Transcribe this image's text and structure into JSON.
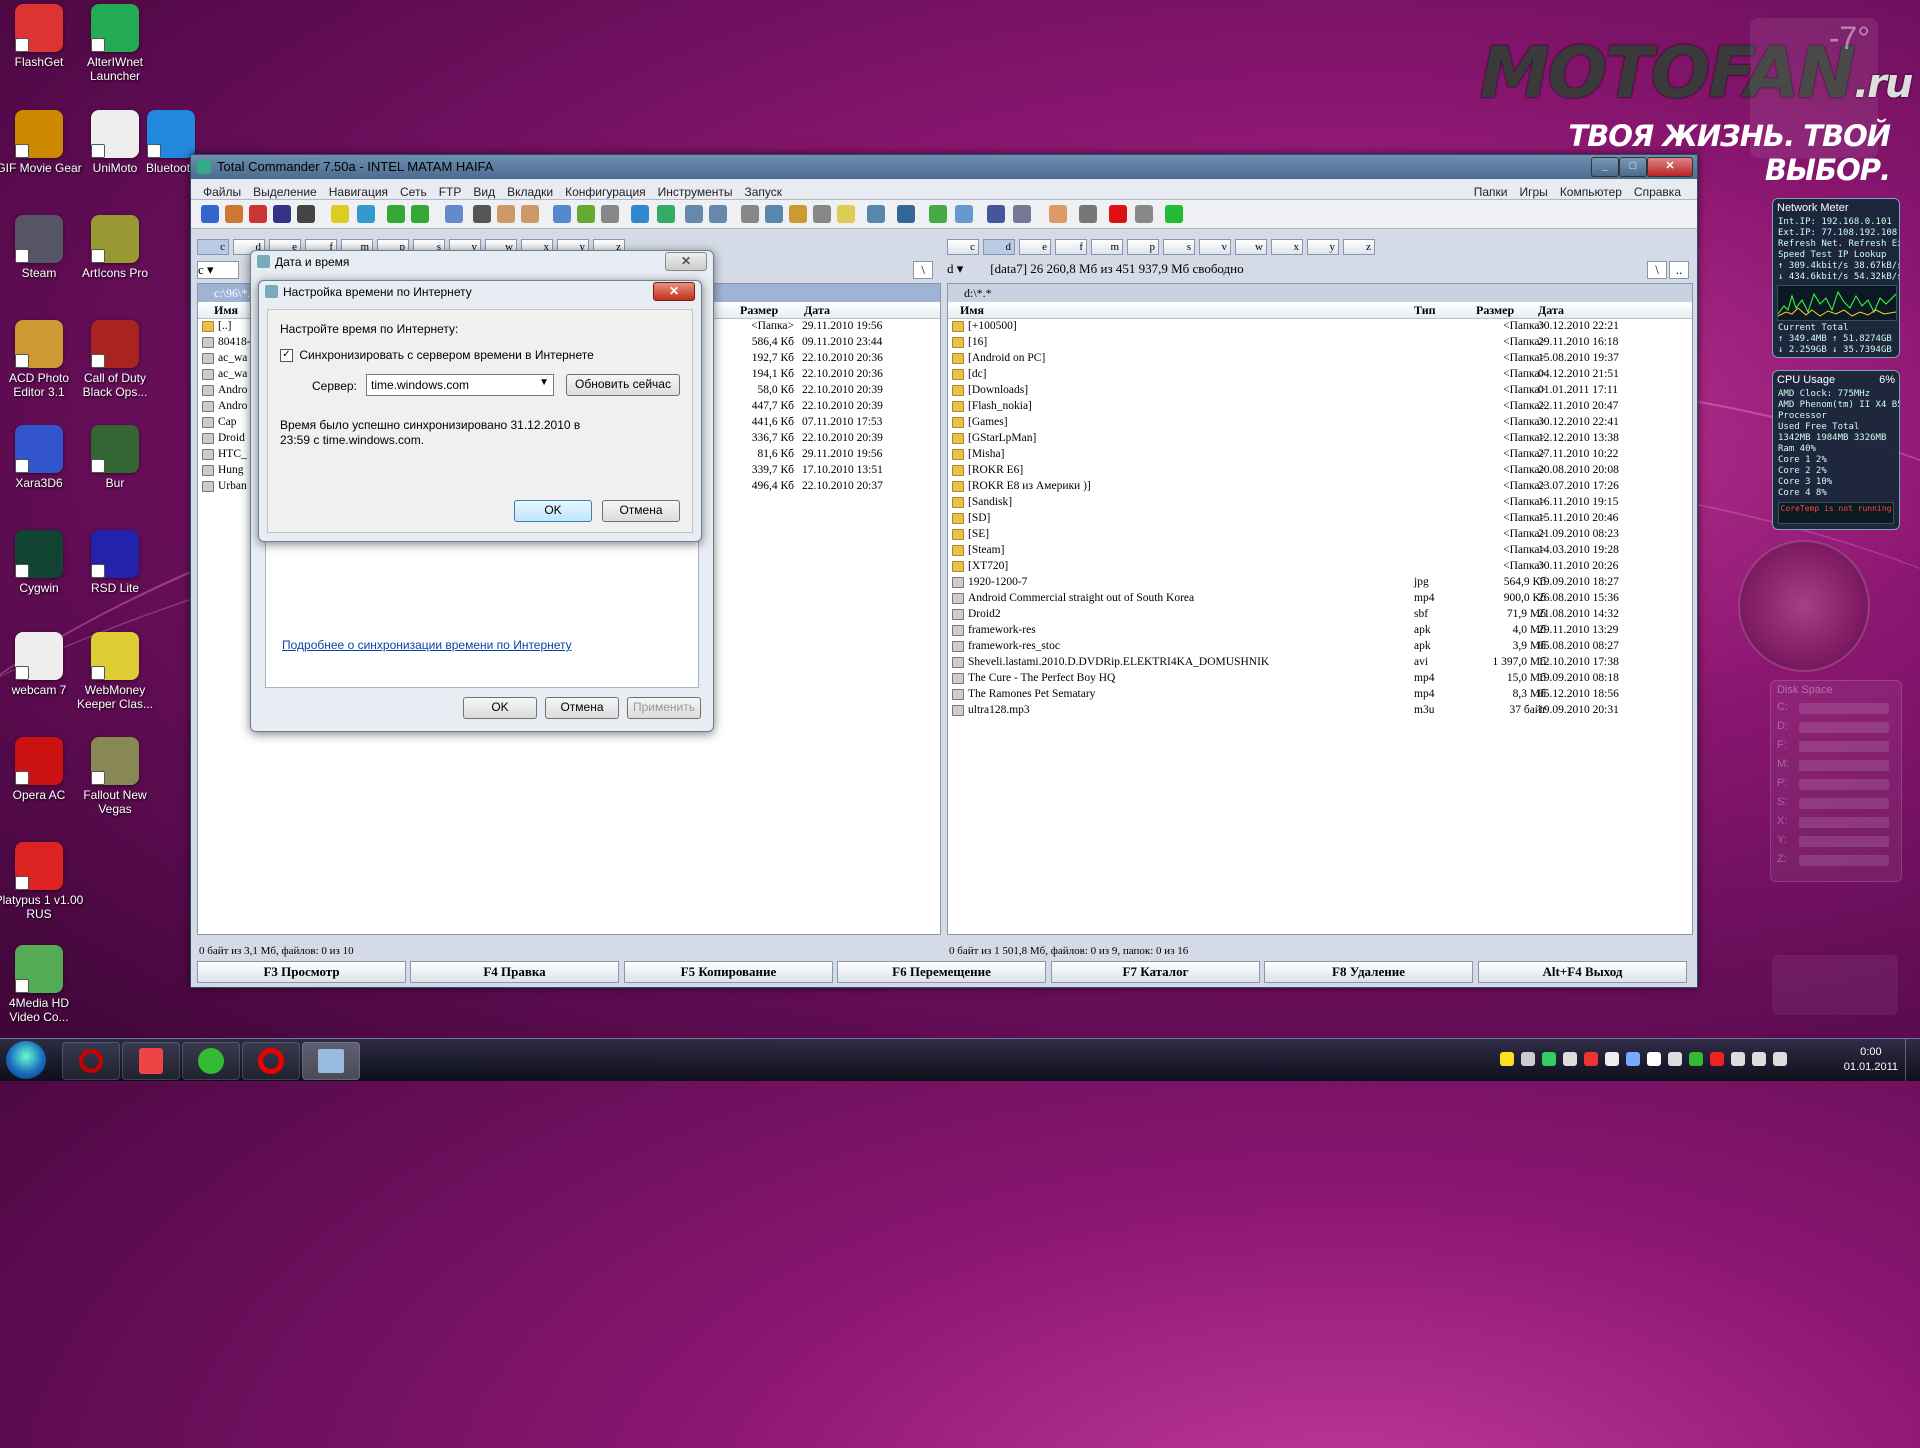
{
  "desktop": {
    "icons": [
      {
        "label": "FlashGet"
      },
      {
        "label": "AlterIWnet Launcher"
      },
      {
        "label": "GIF Movie Gear"
      },
      {
        "label": "UniMoto"
      },
      {
        "label": "Bluetooth"
      },
      {
        "label": "Steam"
      },
      {
        "label": "ArtIcons Pro"
      },
      {
        "label": "ACD Photo Editor 3.1"
      },
      {
        "label": "Call of Duty Black Ops..."
      },
      {
        "label": "Xara3D6"
      },
      {
        "label": "Bur"
      },
      {
        "label": "Cygwin"
      },
      {
        "label": "RSD Lite"
      },
      {
        "label": "webcam 7"
      },
      {
        "label": "WebMoney Keeper Clas..."
      },
      {
        "label": "Opera AC"
      },
      {
        "label": "Fallout New Vegas"
      },
      {
        "label": "Platypus 1 v1.00 RUS"
      },
      {
        "label": "4Media HD Video Co..."
      }
    ],
    "logo_main": "MOTOFAN",
    "logo_ru": ".ru",
    "logo_sub": "ТВОЯ ЖИЗНЬ. ТВОЙ ВЫБОР.",
    "weather_temp": "-7°"
  },
  "gadgets": {
    "network": {
      "title": "Network Meter",
      "rows": [
        "Int.IP: 192.168.0.101",
        "Ext.IP: 77.108.192.108",
        "Refresh Net.   Refresh Ext.",
        "Speed Test     IP Lookup",
        "↑ 309.4kbit/s   38.67kB/s",
        "↓ 434.6kbit/s   54.32kB/s"
      ],
      "foot": [
        "Current       Total",
        "↑ 349.4MB   ↑ 51.8274GB",
        "↓ 2.259GB   ↓ 35.7394GB"
      ]
    },
    "cpu": {
      "title": "CPU Usage",
      "percent": "6%",
      "rows": [
        "AMD     Clock:  775MHz",
        "AMD Phenom(tm) II X4 B50",
        "Processor",
        "Used     Free     Total",
        "1342MB  1984MB  3326MB",
        "Ram          40%",
        "Core 1        2%",
        "Core 2        2%",
        "Core 3       10%",
        "Core 4        8%"
      ],
      "warn": "CoreTemp is not running"
    },
    "disk": {
      "title": "Disk Space",
      "drives": [
        "C:",
        "D:",
        "F:",
        "M:",
        "P:",
        "S:",
        "X:",
        "Y:",
        "Z:"
      ]
    }
  },
  "tc": {
    "title": "Total Commander 7.50a - INTEL MATAM HAIFA",
    "menu": [
      "Файлы",
      "Выделение",
      "Навигация",
      "Сеть",
      "FTP",
      "Вид",
      "Вкладки",
      "Конфигурация",
      "Инструменты",
      "Запуск"
    ],
    "menu_right": [
      "Папки",
      "Игры",
      "Компьютер",
      "Справка"
    ],
    "left": {
      "drives": [
        "c",
        "d",
        "e",
        "f",
        "m",
        "p",
        "s",
        "v",
        "w",
        "x",
        "y",
        "z"
      ],
      "drive_sel": "c",
      "path": "c:\\96\\*.*",
      "cols": {
        "name": "Имя",
        "size": "Размер",
        "date": "Дата"
      },
      "files": [
        {
          "name": "[..]",
          "size": "<Папка>",
          "date": "29.11.2010 19:56",
          "type": "folder"
        },
        {
          "name": "80418-",
          "size": "586,4 Кб",
          "date": "09.11.2010 23:44",
          "type": "file"
        },
        {
          "name": "ac_wa",
          "size": "192,7 Кб",
          "date": "22.10.2010 20:36",
          "type": "file"
        },
        {
          "name": "ac_wa",
          "size": "194,1 Кб",
          "date": "22.10.2010 20:36",
          "type": "file"
        },
        {
          "name": "Andro",
          "size": "58,0 Кб",
          "date": "22.10.2010 20:39",
          "type": "file"
        },
        {
          "name": "Andro",
          "size": "447,7 Кб",
          "date": "22.10.2010 20:39",
          "type": "file"
        },
        {
          "name": "Cap",
          "size": "441,6 Кб",
          "date": "07.11.2010 17:53",
          "type": "file"
        },
        {
          "name": "Droid",
          "size": "336,7 Кб",
          "date": "22.10.2010 20:39",
          "type": "file"
        },
        {
          "name": "HTC_",
          "size": "81,6 Кб",
          "date": "29.11.2010 19:56",
          "type": "file"
        },
        {
          "name": "Hung",
          "size": "339,7 Кб",
          "date": "17.10.2010 13:51",
          "type": "file"
        },
        {
          "name": "Urban",
          "size": "496,4 Кб",
          "date": "22.10.2010 20:37",
          "type": "file"
        }
      ],
      "status": "0 байт из 3,1 Мб, файлов: 0 из 10"
    },
    "right": {
      "drives": [
        "c",
        "d",
        "e",
        "f",
        "m",
        "p",
        "s",
        "v",
        "w",
        "x",
        "y",
        "z"
      ],
      "drive_sel": "d",
      "drive_letter": "d",
      "drive_info": "[data7]  26 260,8 Мб из 451 937,9 Мб свободно",
      "path": "d:\\*.*",
      "cols": {
        "name": "Имя",
        "type": "Тип",
        "size": "Размер",
        "date": "Дата"
      },
      "files": [
        {
          "name": "[+100500]",
          "ext": "",
          "size": "<Папка>",
          "date": "30.12.2010 22:21",
          "type": "folder"
        },
        {
          "name": "[16]",
          "ext": "",
          "size": "<Папка>",
          "date": "29.11.2010 16:18",
          "type": "folder"
        },
        {
          "name": "[Android on PC]",
          "ext": "",
          "size": "<Папка>",
          "date": "15.08.2010 19:37",
          "type": "folder"
        },
        {
          "name": "[dc]",
          "ext": "",
          "size": "<Папка>",
          "date": "04.12.2010 21:51",
          "type": "folder"
        },
        {
          "name": "[Downloads]",
          "ext": "",
          "size": "<Папка>",
          "date": "01.01.2011 17:11",
          "type": "folder"
        },
        {
          "name": "[Flash_nokia]",
          "ext": "",
          "size": "<Папка>",
          "date": "22.11.2010 20:47",
          "type": "folder"
        },
        {
          "name": "[Games]",
          "ext": "",
          "size": "<Папка>",
          "date": "30.12.2010 22:41",
          "type": "folder"
        },
        {
          "name": "[GStarLpMan]",
          "ext": "",
          "size": "<Папка>",
          "date": "12.12.2010 13:38",
          "type": "folder"
        },
        {
          "name": "[Misha]",
          "ext": "",
          "size": "<Папка>",
          "date": "27.11.2010 10:22",
          "type": "folder"
        },
        {
          "name": "[ROKR E6]",
          "ext": "",
          "size": "<Папка>",
          "date": "20.08.2010 20:08",
          "type": "folder"
        },
        {
          "name": "[ROKR E8 из Америки )]",
          "ext": "",
          "size": "<Папка>",
          "date": "23.07.2010 17:26",
          "type": "folder"
        },
        {
          "name": "[Sandisk]",
          "ext": "",
          "size": "<Папка>",
          "date": "16.11.2010 19:15",
          "type": "folder"
        },
        {
          "name": "[SD]",
          "ext": "",
          "size": "<Папка>",
          "date": "15.11.2010 20:46",
          "type": "folder"
        },
        {
          "name": "[SE]",
          "ext": "",
          "size": "<Папка>",
          "date": "21.09.2010 08:23",
          "type": "folder"
        },
        {
          "name": "[Steam]",
          "ext": "",
          "size": "<Папка>",
          "date": "14.03.2010 19:28",
          "type": "folder"
        },
        {
          "name": "[XT720]",
          "ext": "",
          "size": "<Папка>",
          "date": "30.11.2010 20:26",
          "type": "folder"
        },
        {
          "name": "1920-1200-7",
          "ext": "jpg",
          "size": "564,9 Кб",
          "date": "19.09.2010 18:27",
          "type": "file"
        },
        {
          "name": "Android Commercial straight out of South Korea",
          "ext": "mp4",
          "size": "900,0 Кб",
          "date": "26.08.2010 15:36",
          "type": "file"
        },
        {
          "name": "Droid2",
          "ext": "sbf",
          "size": "71,9 Мб",
          "date": "21.08.2010 14:32",
          "type": "file"
        },
        {
          "name": "framework-res",
          "ext": "apk",
          "size": "4,0 Мб",
          "date": "29.11.2010 13:29",
          "type": "file"
        },
        {
          "name": "framework-res_stoc",
          "ext": "apk",
          "size": "3,9 Мб",
          "date": "05.08.2010 08:27",
          "type": "file"
        },
        {
          "name": "Sheveli.lastami.2010.D.DVDRip.ELEKTRI4KA_DOMUSHNIK",
          "ext": "avi",
          "size": "1 397,0 Мб",
          "date": "12.10.2010 17:38",
          "type": "file"
        },
        {
          "name": "The Cure - The Perfect Boy HQ",
          "ext": "mp4",
          "size": "15,0 Мб",
          "date": "19.09.2010 08:18",
          "type": "file"
        },
        {
          "name": "The Ramones Pet Sematary",
          "ext": "mp4",
          "size": "8,3 Мб",
          "date": "05.12.2010 18:56",
          "type": "file"
        },
        {
          "name": "ultra128.mp3",
          "ext": "m3u",
          "size": "37 байт",
          "date": "19.09.2010 20:31",
          "type": "file"
        }
      ],
      "status": "0 байт из 1 501,8 Мб, файлов: 0 из 9, папок: 0 из 16"
    },
    "fkeys": [
      "F3 Просмотр",
      "F4 Правка",
      "F5 Копирование",
      "F6 Перемещение",
      "F7 Каталог",
      "F8 Удаление",
      "Alt+F4 Выход"
    ]
  },
  "datetime_dialog": {
    "title": "Дата и время",
    "link": "Подробнее о синхронизации времени по Интернету",
    "ok": "OK",
    "cancel": "Отмена",
    "apply": "Применить"
  },
  "inet_dialog": {
    "title": "Настройка времени по Интернету",
    "heading": "Настройте время по Интернету:",
    "checkbox_label": "Синхронизировать с сервером времени в Интернете",
    "checked": true,
    "server_label": "Сервер:",
    "server_value": "time.windows.com",
    "update_button": "Обновить сейчас",
    "message": "Время было успешно синхронизировано 31.12.2010 в 23:59 с time.windows.com.",
    "ok": "OK",
    "cancel": "Отмена"
  },
  "taskbar": {
    "clock_time": "0:00",
    "clock_date": "01.01.2011"
  }
}
